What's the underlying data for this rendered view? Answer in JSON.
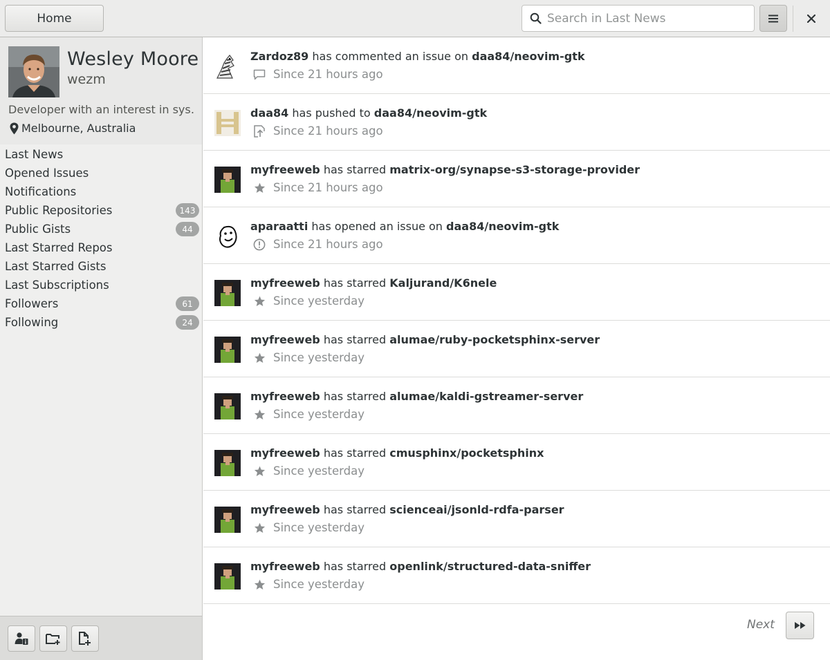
{
  "header": {
    "home_label": "Home",
    "search_placeholder": "Search in Last News",
    "menu_icon": "hamburger-icon",
    "close_icon": "close-icon"
  },
  "profile": {
    "name": "Wesley Moore",
    "login": "wezm",
    "bio": "Developer with an interest in sys…",
    "location": "Melbourne, Australia"
  },
  "nav": [
    {
      "label": "Last News",
      "badge": null
    },
    {
      "label": "Opened Issues",
      "badge": null
    },
    {
      "label": "Notifications",
      "badge": null
    },
    {
      "label": "Public Repositories",
      "badge": "143"
    },
    {
      "label": "Public Gists",
      "badge": "44"
    },
    {
      "label": "Last Starred Repos",
      "badge": null
    },
    {
      "label": "Last Starred Gists",
      "badge": null
    },
    {
      "label": "Last Subscriptions",
      "badge": null
    },
    {
      "label": "Followers",
      "badge": "61"
    },
    {
      "label": "Following",
      "badge": "24"
    }
  ],
  "feed": [
    {
      "user": "Zardoz89",
      "action": "has commented an issue on",
      "repo": "daa84/neovim-gtk",
      "time": "Since 21 hours ago",
      "icon": "comment-icon",
      "avatar": "zebra"
    },
    {
      "user": "daa84",
      "action": "has pushed to",
      "repo": "daa84/neovim-gtk",
      "time": "Since 21 hours ago",
      "icon": "push-icon",
      "avatar": "identicon"
    },
    {
      "user": "myfreeweb",
      "action": "has starred",
      "repo": "matrix-org/synapse-s3-storage-provider",
      "time": "Since 21 hours ago",
      "icon": "star-icon",
      "avatar": "pixel"
    },
    {
      "user": "aparaatti",
      "action": "has opened an issue on",
      "repo": "daa84/neovim-gtk",
      "time": "Since 21 hours ago",
      "icon": "issue-icon",
      "avatar": "face"
    },
    {
      "user": "myfreeweb",
      "action": "has starred",
      "repo": "Kaljurand/K6nele",
      "time": "Since yesterday",
      "icon": "star-icon",
      "avatar": "pixel"
    },
    {
      "user": "myfreeweb",
      "action": "has starred",
      "repo": "alumae/ruby-pocketsphinx-server",
      "time": "Since yesterday",
      "icon": "star-icon",
      "avatar": "pixel"
    },
    {
      "user": "myfreeweb",
      "action": "has starred",
      "repo": "alumae/kaldi-gstreamer-server",
      "time": "Since yesterday",
      "icon": "star-icon",
      "avatar": "pixel"
    },
    {
      "user": "myfreeweb",
      "action": "has starred",
      "repo": "cmusphinx/pocketsphinx",
      "time": "Since yesterday",
      "icon": "star-icon",
      "avatar": "pixel"
    },
    {
      "user": "myfreeweb",
      "action": "has starred",
      "repo": "scienceai/jsonld-rdfa-parser",
      "time": "Since yesterday",
      "icon": "star-icon",
      "avatar": "pixel"
    },
    {
      "user": "myfreeweb",
      "action": "has starred",
      "repo": "openlink/structured-data-sniffer",
      "time": "Since yesterday",
      "icon": "star-icon",
      "avatar": "pixel"
    }
  ],
  "pagination": {
    "next_label": "Next",
    "next_icon": "fast-forward-icon"
  },
  "sidebar_tools": [
    {
      "icon": "user-info-icon"
    },
    {
      "icon": "new-folder-icon"
    },
    {
      "icon": "new-file-icon"
    }
  ]
}
